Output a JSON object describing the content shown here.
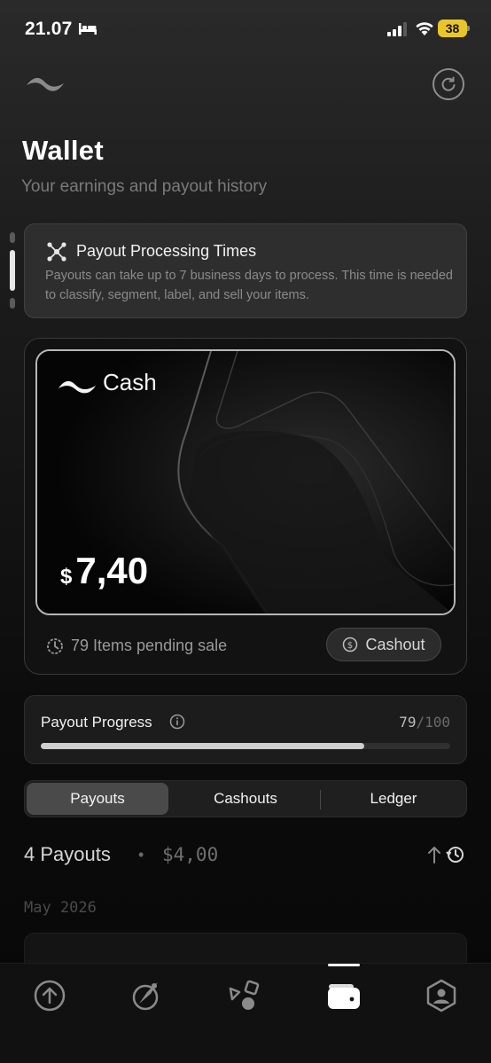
{
  "status_bar": {
    "time": "21.07",
    "battery": "38",
    "icons": [
      "bed-icon",
      "signal-icon",
      "wifi-icon",
      "battery-icon"
    ]
  },
  "header": {
    "logo_icon": "wave-logo-icon",
    "refresh_icon": "refresh-icon",
    "title": "Wallet",
    "subtitle": "Your earnings and payout history"
  },
  "info_card": {
    "icon": "network-icon",
    "title": "Payout Processing Times",
    "body": "Payouts can take up to 7 business days to process. This time is needed to classify, segment, label, and sell your items."
  },
  "cash_card": {
    "label": "Cash",
    "currency": "$",
    "amount": "7,40",
    "pending_text": "79 Items pending sale",
    "cashout_label": "Cashout"
  },
  "progress": {
    "title": "Payout Progress",
    "current": "79",
    "separator": "/",
    "total": "100",
    "fraction": 0.79
  },
  "tabs": [
    {
      "label": "Payouts",
      "active": true
    },
    {
      "label": "Cashouts",
      "active": false
    },
    {
      "label": "Ledger",
      "active": false
    }
  ],
  "payouts_summary": {
    "count_label": "4 Payouts",
    "dot": "•",
    "total": "$4,00",
    "month": "May 2026"
  },
  "bottom_nav": [
    {
      "icon": "upload-icon",
      "active": false
    },
    {
      "icon": "compass-icon",
      "active": false
    },
    {
      "icon": "shapes-icon",
      "active": false
    },
    {
      "icon": "wallet-icon",
      "active": true
    },
    {
      "icon": "profile-icon",
      "active": false
    }
  ],
  "colors": {
    "background": "#1c1c1c",
    "accent": "#ffffff",
    "battery": "#e8c62a",
    "muted": "#7a7a7a"
  }
}
